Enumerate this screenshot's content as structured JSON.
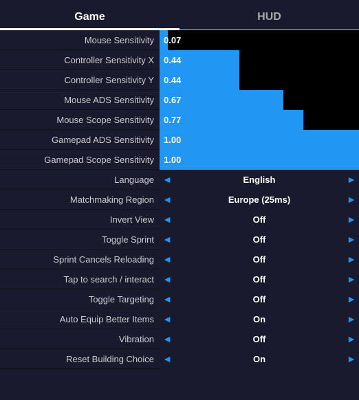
{
  "tabs": [
    {
      "id": "game",
      "label": "Game",
      "active": true
    },
    {
      "id": "hud",
      "label": "HUD",
      "active": false
    }
  ],
  "settings": [
    {
      "id": "mouse-sensitivity",
      "label": "Mouse Sensitivity",
      "type": "slider",
      "value": "0.07",
      "fillPercent": 4
    },
    {
      "id": "controller-sensitivity-x",
      "label": "Controller Sensitivity X",
      "type": "slider",
      "value": "0.44",
      "fillPercent": 40
    },
    {
      "id": "controller-sensitivity-y",
      "label": "Controller Sensitivity Y",
      "type": "slider",
      "value": "0.44",
      "fillPercent": 40
    },
    {
      "id": "mouse-ads-sensitivity",
      "label": "Mouse ADS Sensitivity",
      "type": "slider",
      "value": "0.67",
      "fillPercent": 62
    },
    {
      "id": "mouse-scope-sensitivity",
      "label": "Mouse Scope Sensitivity",
      "type": "slider",
      "value": "0.77",
      "fillPercent": 72
    },
    {
      "id": "gamepad-ads-sensitivity",
      "label": "Gamepad ADS Sensitivity",
      "type": "slider",
      "value": "1.00",
      "fillPercent": 100
    },
    {
      "id": "gamepad-scope-sensitivity",
      "label": "Gamepad Scope Sensitivity",
      "type": "slider",
      "value": "1.00",
      "fillPercent": 100
    },
    {
      "id": "language",
      "label": "Language",
      "type": "selector",
      "value": "English"
    },
    {
      "id": "matchmaking-region",
      "label": "Matchmaking Region",
      "type": "selector",
      "value": "Europe (25ms)"
    },
    {
      "id": "invert-view",
      "label": "Invert View",
      "type": "selector",
      "value": "Off"
    },
    {
      "id": "toggle-sprint",
      "label": "Toggle Sprint",
      "type": "selector",
      "value": "Off"
    },
    {
      "id": "sprint-cancels-reloading",
      "label": "Sprint Cancels Reloading",
      "type": "selector",
      "value": "Off"
    },
    {
      "id": "tap-to-search",
      "label": "Tap to search / interact",
      "type": "selector",
      "value": "Off"
    },
    {
      "id": "toggle-targeting",
      "label": "Toggle Targeting",
      "type": "selector",
      "value": "Off"
    },
    {
      "id": "auto-equip-better-items",
      "label": "Auto Equip Better Items",
      "type": "selector",
      "value": "On"
    },
    {
      "id": "vibration",
      "label": "Vibration",
      "type": "selector",
      "value": "Off"
    },
    {
      "id": "reset-building-choice",
      "label": "Reset Building Choice",
      "type": "selector",
      "value": "On"
    }
  ]
}
